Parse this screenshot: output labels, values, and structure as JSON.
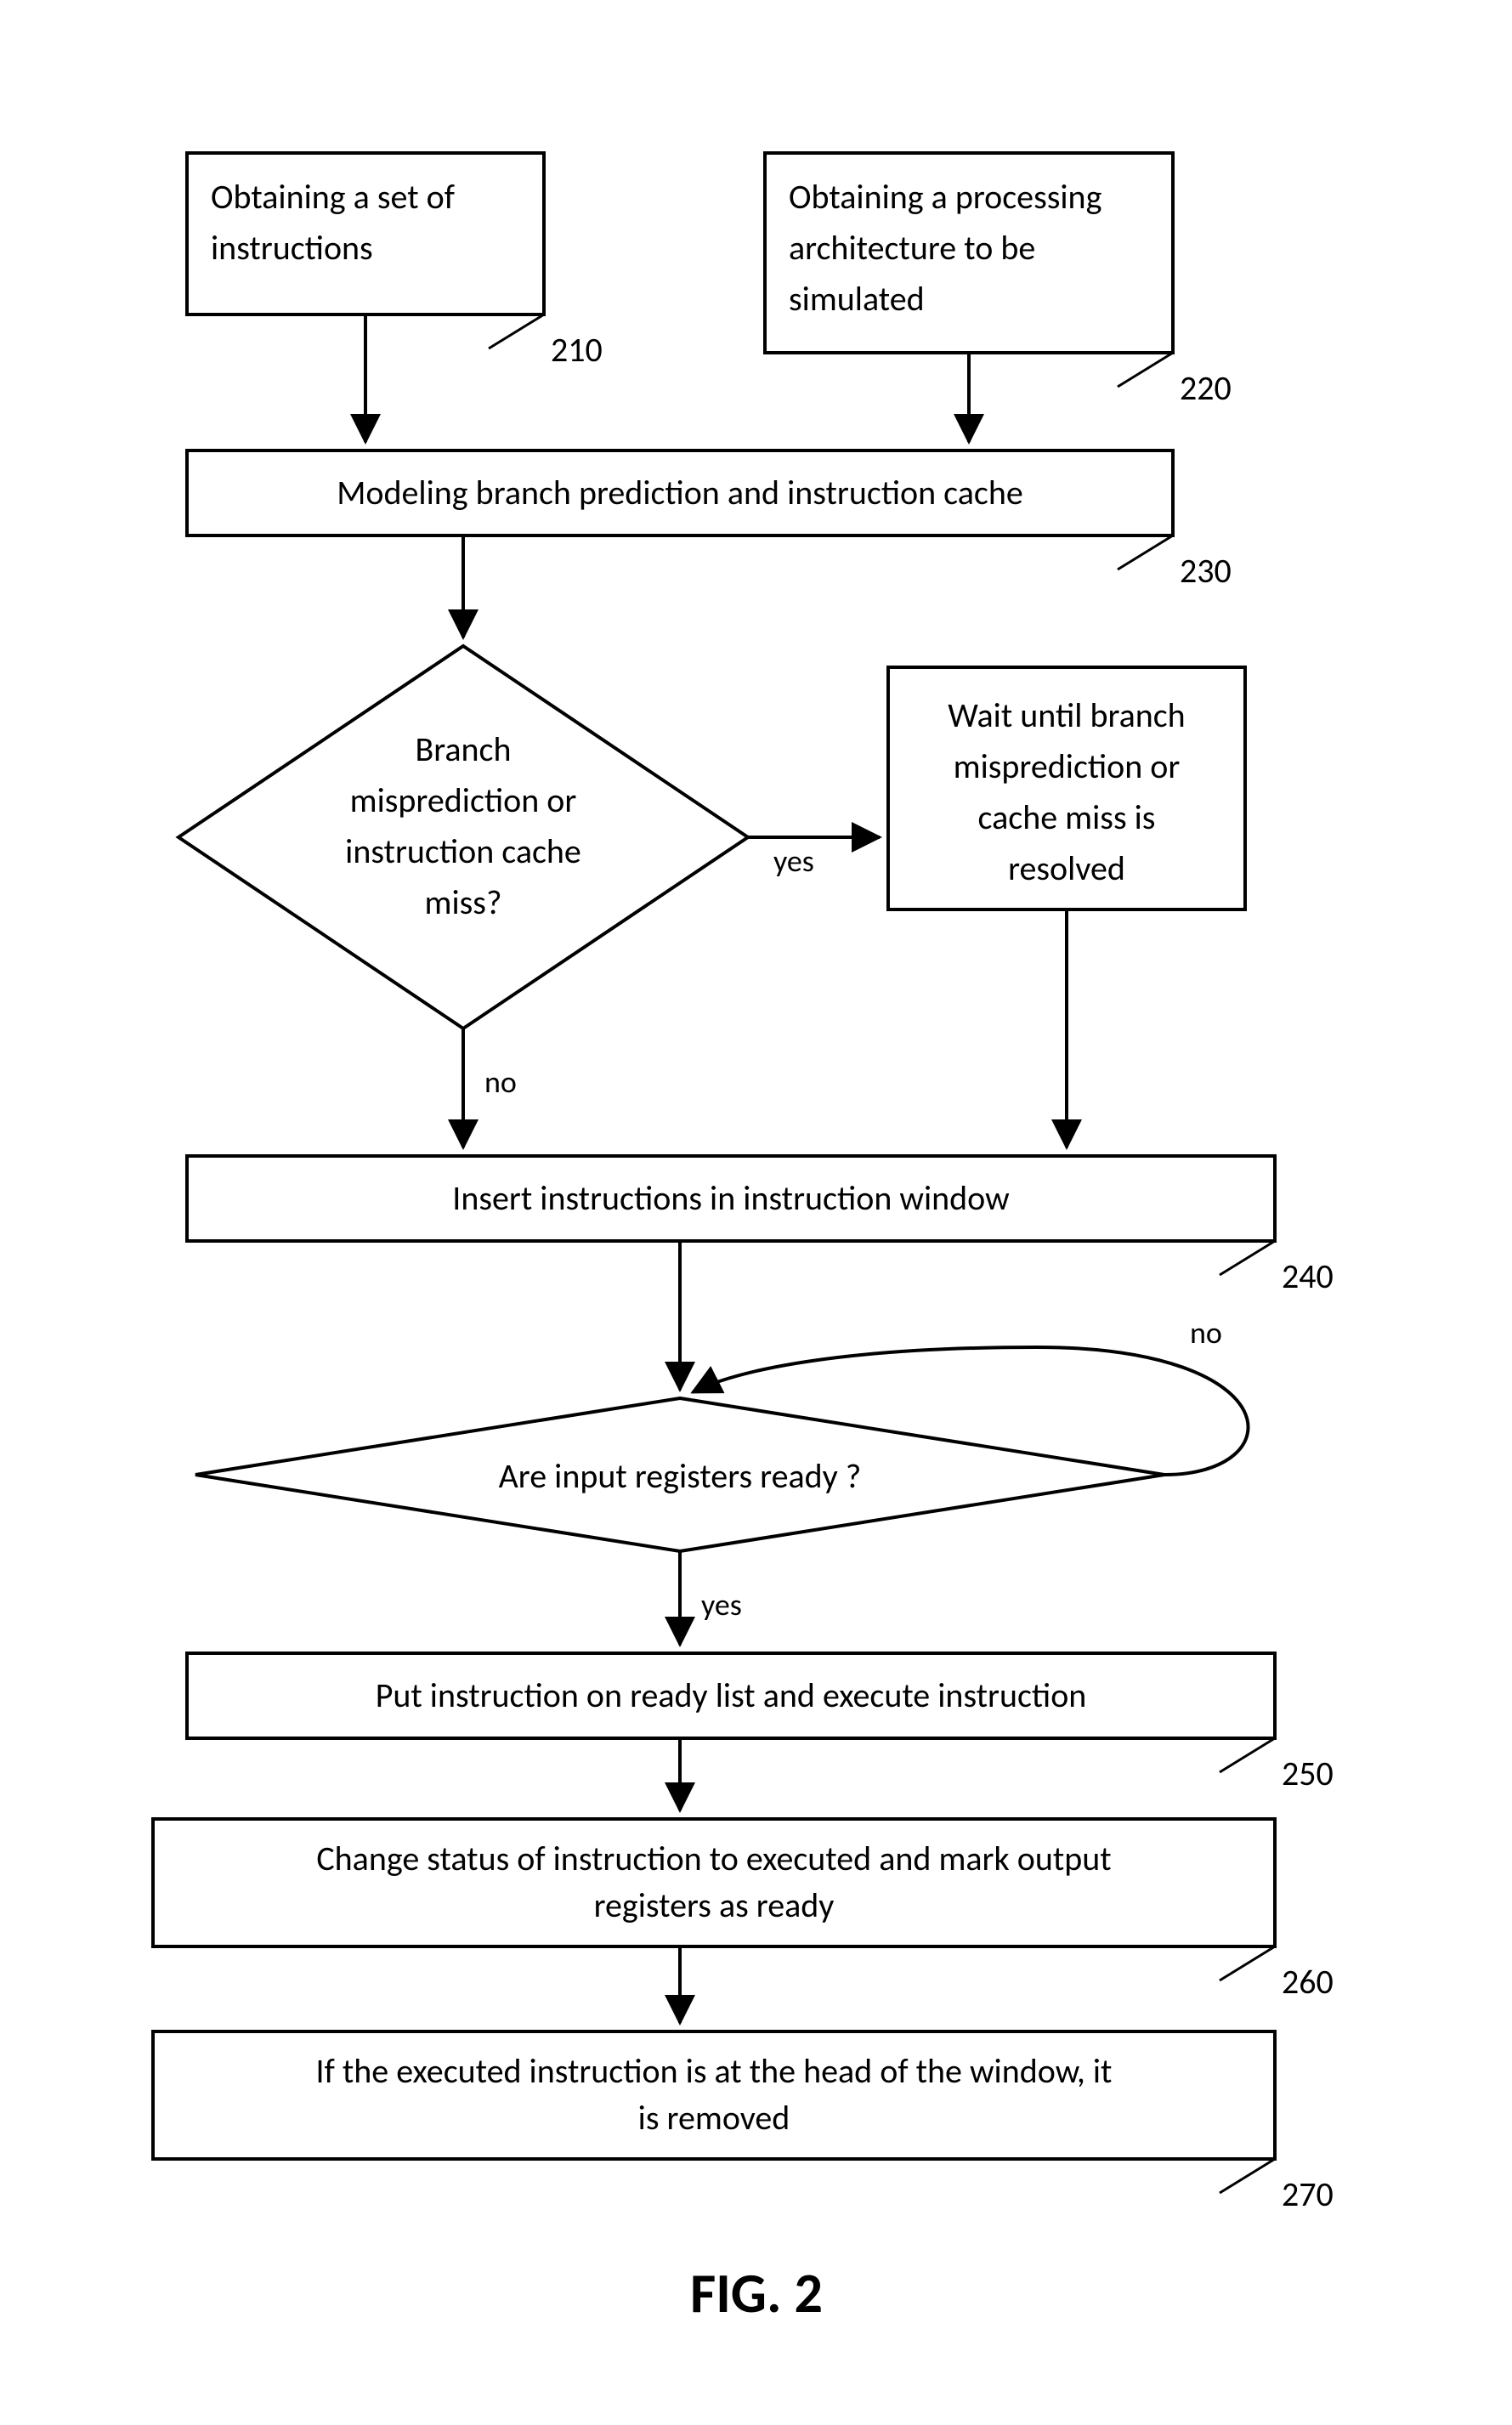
{
  "chart_data": {
    "type": "flowchart",
    "title": "FIG. 2",
    "nodes": [
      {
        "id": "210",
        "type": "process",
        "text_lines": [
          "Obtaining a set of",
          "instructions"
        ],
        "ref": "210"
      },
      {
        "id": "220",
        "type": "process",
        "text_lines": [
          "Obtaining a processing",
          "architecture to be",
          "simulated"
        ],
        "ref": "220"
      },
      {
        "id": "230",
        "type": "process",
        "text_lines": [
          "Modeling branch prediction and instruction cache"
        ],
        "ref": "230"
      },
      {
        "id": "D1",
        "type": "decision",
        "text_lines": [
          "Branch",
          "misprediction or",
          "instruction cache",
          "miss?"
        ]
      },
      {
        "id": "wait",
        "type": "process",
        "text_lines": [
          "Wait until branch",
          "misprediction or",
          "cache miss is",
          "resolved"
        ]
      },
      {
        "id": "240",
        "type": "process",
        "text_lines": [
          "Insert instructions in instruction window"
        ],
        "ref": "240"
      },
      {
        "id": "D2",
        "type": "decision",
        "text_lines": [
          "Are input registers ready ?"
        ]
      },
      {
        "id": "250",
        "type": "process",
        "text_lines": [
          "Put instruction on ready list and execute instruction"
        ],
        "ref": "250"
      },
      {
        "id": "260",
        "type": "process",
        "text_lines": [
          "Change status of instruction to executed and mark output",
          "registers as ready"
        ],
        "ref": "260"
      },
      {
        "id": "270",
        "type": "process",
        "text_lines": [
          "If the executed instruction is at the head of the window, it",
          "is removed"
        ],
        "ref": "270"
      }
    ],
    "edges": [
      {
        "from": "210",
        "to": "230"
      },
      {
        "from": "220",
        "to": "230"
      },
      {
        "from": "230",
        "to": "D1"
      },
      {
        "from": "D1",
        "to": "wait",
        "label": "yes"
      },
      {
        "from": "D1",
        "to": "240",
        "label": "no"
      },
      {
        "from": "wait",
        "to": "240"
      },
      {
        "from": "240",
        "to": "D2"
      },
      {
        "from": "D2",
        "to": "D2",
        "label": "no"
      },
      {
        "from": "D2",
        "to": "250",
        "label": "yes"
      },
      {
        "from": "250",
        "to": "260"
      },
      {
        "from": "260",
        "to": "270"
      }
    ]
  },
  "labels": {
    "yes": "yes",
    "no": "no",
    "figure": "FIG. 2"
  },
  "refs": {
    "r210": "210",
    "r220": "220",
    "r230": "230",
    "r240": "240",
    "r250": "250",
    "r260": "260",
    "r270": "270"
  }
}
